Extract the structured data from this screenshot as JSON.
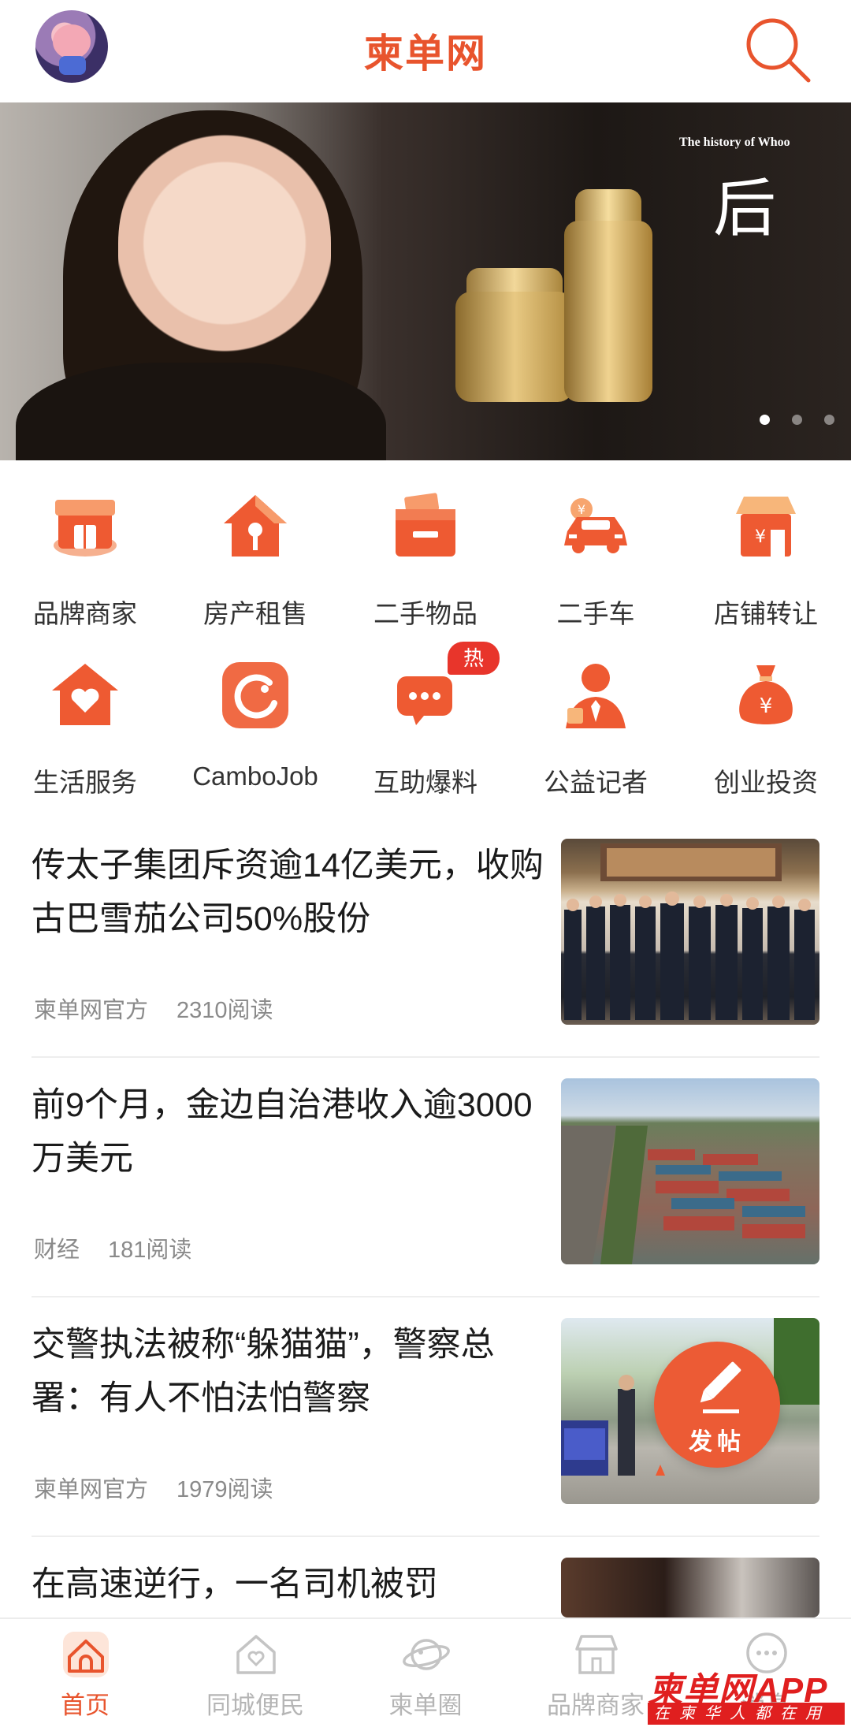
{
  "header": {
    "title": "柬单网",
    "avatar_icon": "pig-avatar",
    "search_icon": "search-icon"
  },
  "banner": {
    "brand_text": "The history of Whoo",
    "brand_glyph": "后",
    "slides": 3,
    "active_slide": 1
  },
  "categories": [
    {
      "label": "品牌商家",
      "icon": "storefront-icon"
    },
    {
      "label": "房产租售",
      "icon": "house-icon"
    },
    {
      "label": "二手物品",
      "icon": "box-icon"
    },
    {
      "label": "二手车",
      "icon": "car-icon"
    },
    {
      "label": "店铺转让",
      "icon": "shop-transfer-icon"
    },
    {
      "label": "生活服务",
      "icon": "home-heart-icon"
    },
    {
      "label": "CamboJob",
      "icon": "cambojob-icon"
    },
    {
      "label": "互助爆料",
      "icon": "chat-bubble-icon",
      "badge": "热"
    },
    {
      "label": "公益记者",
      "icon": "reporter-icon"
    },
    {
      "label": "创业投资",
      "icon": "money-bag-icon"
    }
  ],
  "news": [
    {
      "title": "传太子集团斥资逾14亿美元，收购古巴雪茄公司50%股份",
      "source": "柬单网官方",
      "reads": "2310阅读"
    },
    {
      "title": "前9个月，金边自治港收入逾3000万美元",
      "source": "财经",
      "reads": "181阅读"
    },
    {
      "title": "交警执法被称“躲猫猫”，警察总署：有人不怕法怕警察",
      "source": "柬单网官方",
      "reads": "1979阅读"
    },
    {
      "title": "在高速逆行，一名司机被罚",
      "source": "",
      "reads": ""
    }
  ],
  "fab": {
    "label": "发帖"
  },
  "bottom_nav": [
    {
      "label": "首页",
      "active": true
    },
    {
      "label": "同城便民",
      "active": false
    },
    {
      "label": "柬单圈",
      "active": false
    },
    {
      "label": "品牌商家",
      "active": false
    },
    {
      "label": "消息",
      "active": false
    }
  ],
  "watermark": {
    "main": "柬单网APP",
    "sub": "在柬华人都在用"
  },
  "colors": {
    "accent": "#e8542d",
    "hot": "#e8352b",
    "text": "#1b1b1b",
    "meta": "#8a8a8a"
  }
}
